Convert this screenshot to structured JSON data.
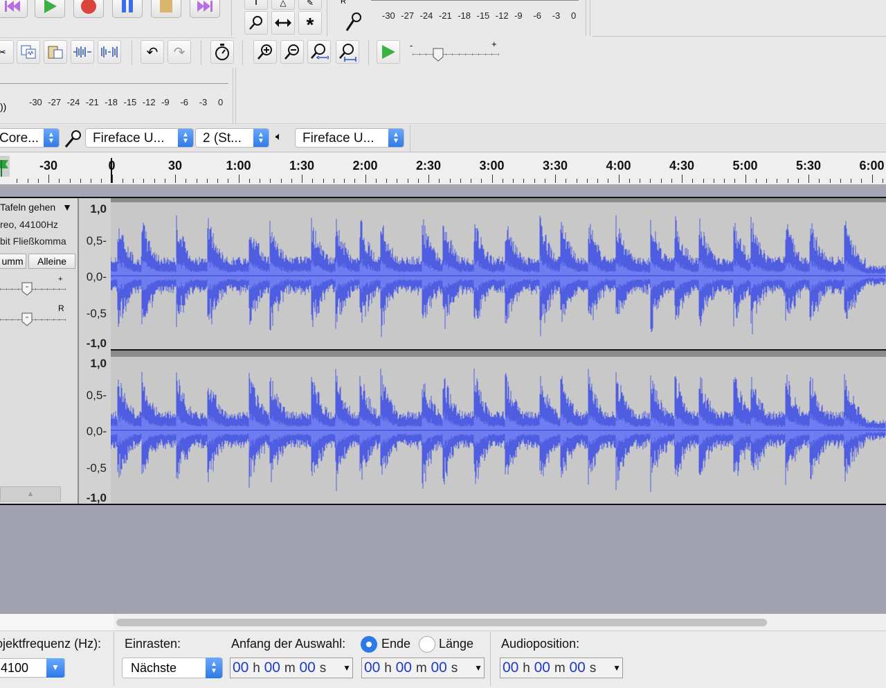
{
  "toolbar": {
    "tool_buttons": [
      "zoom-tool",
      "time-shift-tool",
      "multi-tool"
    ],
    "edit_buttons": [
      "cut",
      "copy",
      "paste",
      "trim",
      "silence",
      "undo",
      "redo",
      "sync-lock",
      "zoom-in",
      "zoom-out",
      "fit-selection",
      "fit-project",
      "play-at-speed"
    ],
    "meter_ticks": [
      "-30",
      "-27",
      "-24",
      "-21",
      "-18",
      "-15",
      "-12",
      "-9",
      "-6",
      "-3",
      "0"
    ],
    "speed_slider": {
      "minus": "-",
      "plus": "+"
    },
    "playback_speed_fraction": 0.3
  },
  "devices": {
    "host": "Core...",
    "recording_device": "Fireface U...",
    "channels": "2 (St...",
    "playback_device": "Fireface U..."
  },
  "ruler": {
    "labels": [
      "-30",
      "0",
      "30",
      "1:00",
      "1:30",
      "2:00",
      "2:30",
      "3:00",
      "3:30",
      "4:00",
      "4:30",
      "5:00",
      "5:30",
      "6:00"
    ]
  },
  "track": {
    "name": "Tafeln gehen",
    "info1": "reo, 44100Hz",
    "info2": "bit Fließkomma",
    "mute_label": "umm",
    "solo_label": "Alleine",
    "gain_plus": "+",
    "pan_right": "R",
    "gain_fraction": 0.5,
    "pan_fraction": 0.5,
    "y_labels": [
      "1,0",
      "0,5-",
      "0,0-",
      "-0,5",
      "-1,0"
    ],
    "waveform_color": "#4f5ee0"
  },
  "bottom": {
    "project_rate_label": "ojektfrequenz (Hz):",
    "project_rate_value": "4100",
    "snap_label": "Einrasten:",
    "snap_value": "Nächste",
    "selection_start_label": "Anfang der Auswahl:",
    "end_label": "Ende",
    "length_label": "Länge",
    "audio_position_label": "Audioposition:",
    "time_h": "00",
    "time_m": "00",
    "time_s": "00",
    "unit_h": "h",
    "unit_m": "m",
    "unit_s": "s"
  },
  "colors": {
    "accent": "#2d79e6",
    "waveform": "#4f5ee0",
    "track_bg": "#c8c8c8",
    "empty_area": "#a0a2b0"
  }
}
